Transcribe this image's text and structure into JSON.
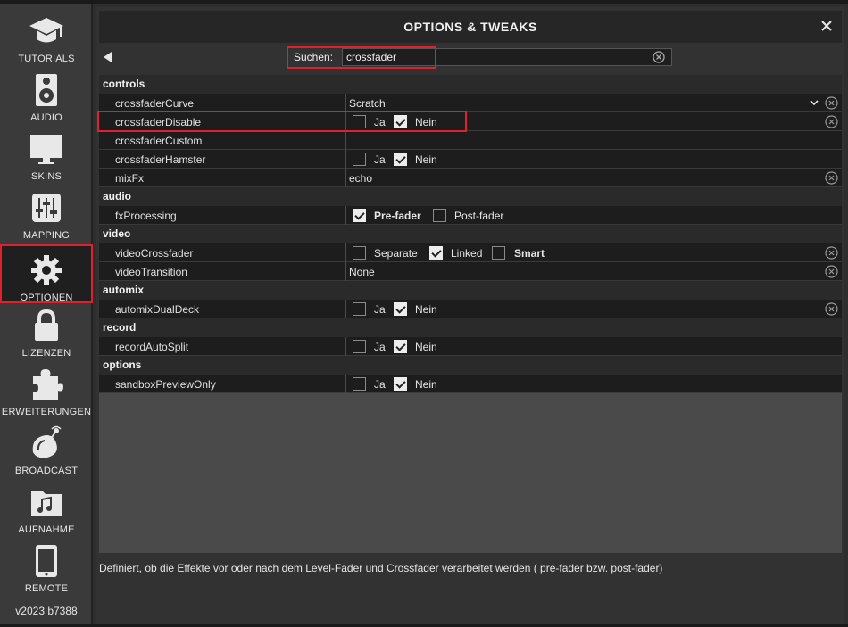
{
  "sidebar": {
    "items": [
      {
        "label": "TUTORIALS",
        "icon": "graduation-cap-icon"
      },
      {
        "label": "AUDIO",
        "icon": "speaker-icon"
      },
      {
        "label": "SKINS",
        "icon": "monitor-icon"
      },
      {
        "label": "MAPPING",
        "icon": "sliders-icon"
      },
      {
        "label": "OPTIONEN",
        "icon": "gear-icon"
      },
      {
        "label": "LIZENZEN",
        "icon": "lock-icon"
      },
      {
        "label": "ERWEITERUNGEN",
        "icon": "puzzle-icon"
      },
      {
        "label": "BROADCAST",
        "icon": "broadcast-icon"
      },
      {
        "label": "AUFNAHME",
        "icon": "music-folder-icon"
      },
      {
        "label": "REMOTE",
        "icon": "phone-icon"
      }
    ],
    "active": "OPTIONEN",
    "version": "v2023 b7388"
  },
  "header": {
    "title": "OPTIONS & TWEAKS"
  },
  "search": {
    "label": "Suchen:",
    "value": "crossfader"
  },
  "sections": {
    "controls": "controls",
    "audio": "audio",
    "video": "video",
    "automix": "automix",
    "record": "record",
    "options": "options"
  },
  "rows": {
    "crossfaderCurve": {
      "name": "crossfaderCurve",
      "value": "Scratch"
    },
    "crossfaderDisable": {
      "name": "crossfaderDisable",
      "opt1": "Ja",
      "opt2": "Nein"
    },
    "crossfaderCustom": {
      "name": "crossfaderCustom"
    },
    "crossfaderHamster": {
      "name": "crossfaderHamster",
      "opt1": "Ja",
      "opt2": "Nein"
    },
    "mixFx": {
      "name": "mixFx",
      "value": "echo"
    },
    "fxProcessing": {
      "name": "fxProcessing",
      "opt1": "Pre-fader",
      "opt2": "Post-fader"
    },
    "videoCrossfader": {
      "name": "videoCrossfader",
      "opt1": "Separate",
      "opt2": "Linked",
      "opt3": "Smart"
    },
    "videoTransition": {
      "name": "videoTransition",
      "value": "None"
    },
    "automixDualDeck": {
      "name": "automixDualDeck",
      "opt1": "Ja",
      "opt2": "Nein"
    },
    "recordAutoSplit": {
      "name": "recordAutoSplit",
      "opt1": "Ja",
      "opt2": "Nein"
    },
    "sandboxPreviewOnly": {
      "name": "sandboxPreviewOnly",
      "opt1": "Ja",
      "opt2": "Nein"
    }
  },
  "description": "Definiert, ob die Effekte vor oder nach dem Level-Fader und Crossfader verarbeitet werden ( pre-fader bzw. post-fader)",
  "colors": {
    "highlight": "#e0202a",
    "row_bg": "#1d1d1d",
    "section_bg": "#2a2a2a"
  }
}
